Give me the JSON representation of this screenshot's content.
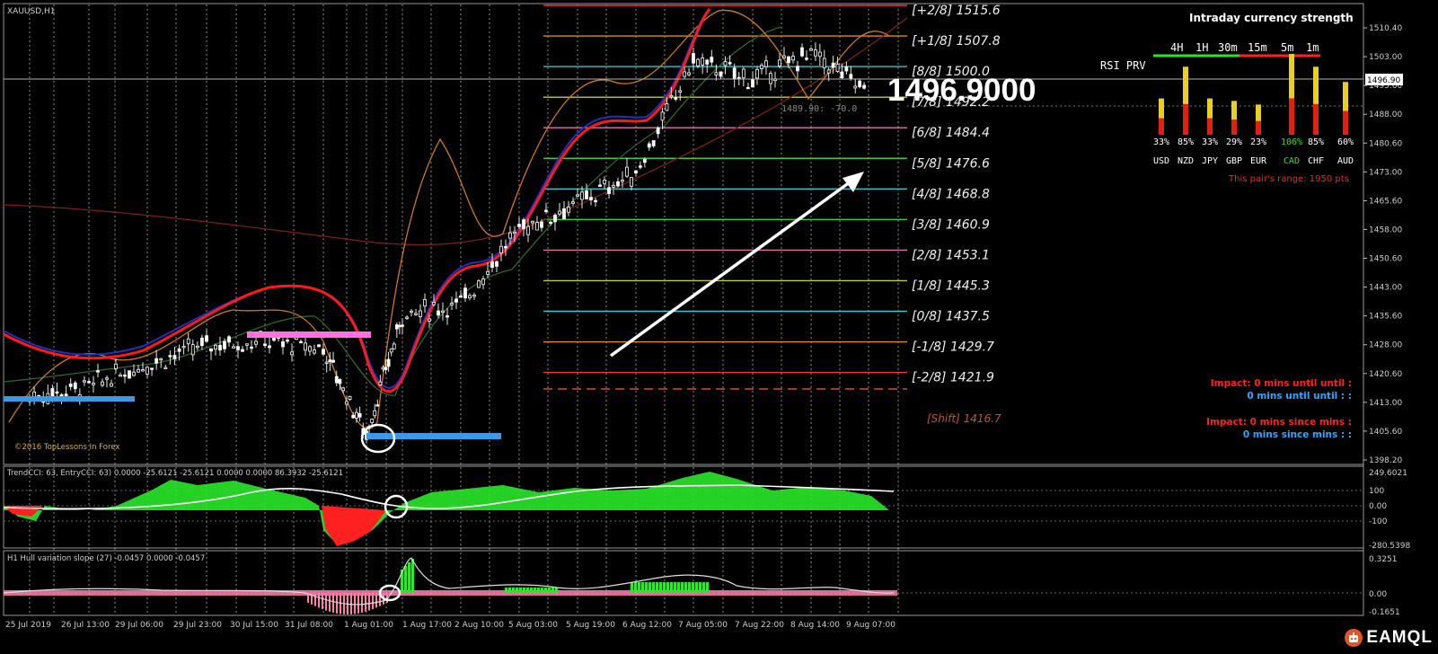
{
  "window": {
    "symbol_label": "XAUUSD,H1"
  },
  "price_axis": {
    "ticks": [
      "1510.40",
      "1503.00",
      "1495.60",
      "1488.00",
      "1480.60",
      "1473.00",
      "1465.60",
      "1458.00",
      "1450.60",
      "1443.00",
      "1435.60",
      "1428.00",
      "1420.60",
      "1413.00",
      "1405.60",
      "1398.20"
    ],
    "current_price": "1496.90"
  },
  "big_price": "1496.9000",
  "tooltip_line": "1489.90: -70.0",
  "time_axis": [
    "25 Jul 2019",
    "26 Jul 13:00",
    "29 Jul 06:00",
    "29 Jul 23:00",
    "30 Jul 15:00",
    "31 Jul 08:00",
    "1 Aug 01:00",
    "1 Aug 17:00",
    "2 Aug 10:00",
    "5 Aug 03:00",
    "5 Aug 19:00",
    "6 Aug 12:00",
    "7 Aug 05:00",
    "7 Aug 22:00",
    "8 Aug 14:00",
    "9 Aug 07:00"
  ],
  "murrey_levels": [
    {
      "label": "[+2/8] 1515.6",
      "color": "#ff3030"
    },
    {
      "label": "[+1/8] 1507.8",
      "color": "#e08c1a"
    },
    {
      "label": "[8/8] 1500.0",
      "color": "#2ec8c8"
    },
    {
      "label": "[7/8] 1492.2",
      "color": "#c8c82e"
    },
    {
      "label": "[6/8] 1484.4",
      "color": "#e070b0"
    },
    {
      "label": "[5/8] 1476.6",
      "color": "#2ed02e"
    },
    {
      "label": "[4/8] 1468.8",
      "color": "#2ec8c8"
    },
    {
      "label": "[3/8] 1460.9",
      "color": "#2ed02e"
    },
    {
      "label": "[2/8] 1453.1",
      "color": "#e070b0"
    },
    {
      "label": "[1/8] 1445.3",
      "color": "#c8c82e"
    },
    {
      "label": "[0/8] 1437.5",
      "color": "#2ec8c8"
    },
    {
      "label": "[-1/8] 1429.7",
      "color": "#e08c1a"
    },
    {
      "label": "[-2/8] 1421.9",
      "color": "#ff3030"
    }
  ],
  "murrey_shift": "[Shift]  1416.7",
  "watermark": "©2016 TopLessons In Forex",
  "strength_panel": {
    "title": "Intraday currency strength",
    "rsi_label": "RSI PRV",
    "timeframes": [
      "4H",
      "1H",
      "30m",
      "15m",
      "5m",
      "1m"
    ],
    "percents": [
      "33%",
      "85%",
      "33%",
      "29%",
      "23%",
      "106%",
      "85%",
      "60%"
    ],
    "currencies": [
      "USD",
      "NZD",
      "JPY",
      "GBP",
      "EUR",
      "CAD",
      "CHF",
      "AUD"
    ],
    "range_text": "This pair's range: 1950 pts",
    "colors": {
      "normal": "#ffffff",
      "highlight": "#30e030",
      "range": "#ff2020"
    }
  },
  "news": {
    "line1": "Impact: 0 mins until until :",
    "line2": "0 mins until until : :",
    "line3": "Impact: 0 mins since  mins :",
    "line4": "0 mins since  mins : :"
  },
  "cci_panel": {
    "title": "TrendCCI: 63, EntryCCI: 63)  0.0000 -25.6121 -25.6121 0.0000 0.0000 86.3932 -25.6121",
    "ticks": [
      "249.6021",
      "100",
      "0.00",
      "-100",
      "-280.5398"
    ]
  },
  "hull_panel": {
    "title": "H1 Hull variation slope (27) -0.0457 0.0000 -0.0457",
    "ticks": [
      "0.3251",
      "0.00",
      "-0.1651"
    ]
  },
  "logo_text": "EAMQL",
  "chart_data": {
    "type": "candlestick",
    "symbol": "XAUUSD",
    "timeframe": "H1",
    "ylim": [
      1398.2,
      1514.0
    ],
    "x": [
      "25 Jul 2019",
      "26 Jul 13:00",
      "29 Jul 06:00",
      "29 Jul 23:00",
      "30 Jul 15:00",
      "31 Jul 08:00",
      "1 Aug 01:00",
      "1 Aug 17:00",
      "2 Aug 10:00",
      "5 Aug 03:00",
      "5 Aug 19:00",
      "6 Aug 12:00",
      "7 Aug 05:00",
      "7 Aug 22:00",
      "8 Aug 14:00",
      "9 Aug 07:00"
    ],
    "close": [
      1415,
      1418,
      1424,
      1429,
      1430,
      1428,
      1405,
      1437,
      1440,
      1460,
      1467,
      1475,
      1505,
      1500,
      1507,
      1496.9
    ],
    "current_price": 1496.9,
    "grid": true
  }
}
